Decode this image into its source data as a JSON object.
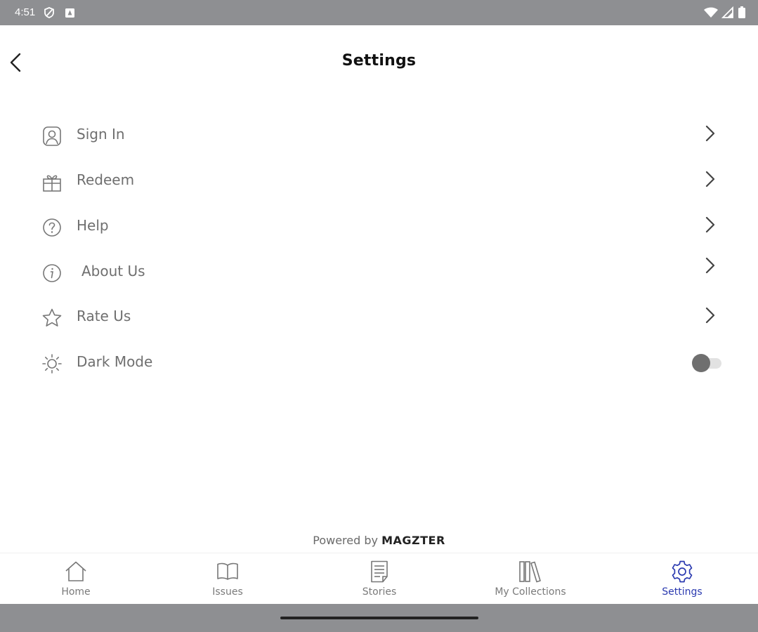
{
  "status_bar": {
    "time": "4:51",
    "icons_left": [
      "vpn-shield-icon",
      "notification-app-icon"
    ],
    "icons_right": [
      "wifi-icon",
      "signal-icon",
      "battery-icon"
    ]
  },
  "header": {
    "title": "Settings",
    "back_icon": "back-arrow-icon"
  },
  "settings": {
    "items": [
      {
        "label": "Sign In",
        "icon": "user-profile-icon",
        "action": "chevron"
      },
      {
        "label": "Redeem",
        "icon": "gift-icon",
        "action": "chevron"
      },
      {
        "label": "Help",
        "icon": "help-circle-icon",
        "action": "chevron"
      },
      {
        "label": "About Us",
        "icon": "info-circle-icon",
        "action": "chevron"
      },
      {
        "label": "Rate Us",
        "icon": "star-icon",
        "action": "chevron"
      },
      {
        "label": "Dark Mode",
        "icon": "sun-icon",
        "action": "toggle",
        "toggle_on": false
      }
    ]
  },
  "footer": {
    "powered_by": "Powered by",
    "brand": "MAGZTER"
  },
  "bottom_nav": {
    "items": [
      {
        "label": "Home",
        "icon": "home-icon",
        "active": false
      },
      {
        "label": "Issues",
        "icon": "book-open-icon",
        "active": false
      },
      {
        "label": "Stories",
        "icon": "document-icon",
        "active": false
      },
      {
        "label": "My Collections",
        "icon": "library-icon",
        "active": false
      },
      {
        "label": "Settings",
        "icon": "gear-icon",
        "active": true
      }
    ]
  },
  "colors": {
    "status_bar": "#8e8f92",
    "label_gray": "#6f6f6f",
    "active_nav": "#2b3ab0",
    "toggle_knob": "#6f6f6f",
    "toggle_track": "#e2e2e2"
  }
}
